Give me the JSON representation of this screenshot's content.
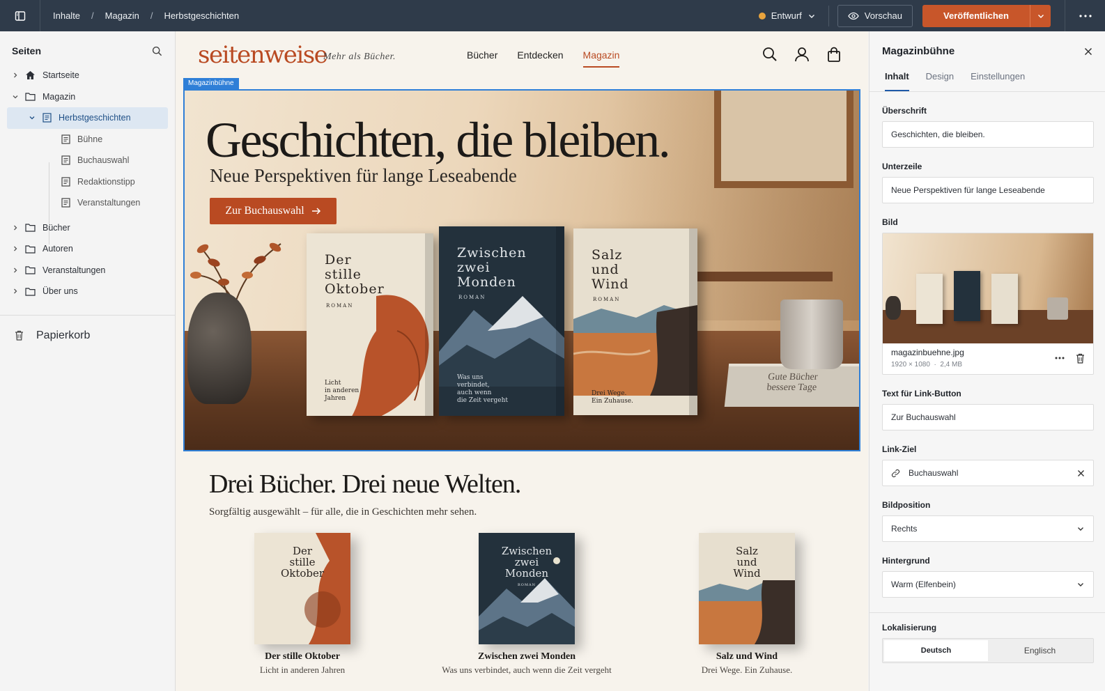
{
  "topbar": {
    "breadcrumbs": [
      "Inhalte",
      "Magazin",
      "Herbstgeschichten"
    ],
    "status": "Entwurf",
    "status_color": "#e8a33d",
    "preview_label": "Vorschau",
    "publish_label": "Veröffentlichen",
    "accent": "#c8562a"
  },
  "sidebar": {
    "title": "Seiten",
    "items": [
      {
        "label": "Startseite",
        "icon": "home-icon"
      },
      {
        "label": "Magazin",
        "icon": "folder-icon"
      },
      {
        "label": "Herbstgeschichten",
        "icon": "page-icon"
      },
      {
        "label": "Bühne",
        "icon": "page-icon"
      },
      {
        "label": "Buchauswahl",
        "icon": "page-icon"
      },
      {
        "label": "Redaktionstipp",
        "icon": "page-icon"
      },
      {
        "label": "Veranstaltungen",
        "icon": "page-icon"
      },
      {
        "label": "Bücher",
        "icon": "folder-icon"
      },
      {
        "label": "Autoren",
        "icon": "folder-icon"
      },
      {
        "label": "Veranstaltungen",
        "icon": "folder-icon"
      },
      {
        "label": "Über uns",
        "icon": "folder-icon"
      }
    ],
    "trash_label": "Papierkorb"
  },
  "site": {
    "logo": "seitenweise",
    "tagline": "Mehr als Bücher.",
    "menu": [
      "Bücher",
      "Entdecken",
      "Magazin"
    ],
    "stage_tag": "Magazinbühne",
    "hero": {
      "title": "Geschichten, die bleiben.",
      "subtitle": "Neue Perspektiven für lange Leseabende",
      "button": "Zur Buchauswahl"
    },
    "hero_books": [
      {
        "title": [
          "Der",
          "stille",
          "Oktober"
        ],
        "label": "ROMAN",
        "tagline": [
          "Licht",
          "in anderen",
          "Jahren"
        ]
      },
      {
        "title": [
          "Zwischen",
          "zwei",
          "Monden"
        ],
        "label": "ROMAN",
        "tagline": [
          "Was uns",
          "verbindet,",
          "auch wenn",
          "die Zeit vergeht"
        ]
      },
      {
        "title": [
          "Salz",
          "und",
          "Wind"
        ],
        "label": "ROMAN",
        "tagline": [
          "Drei Wege.",
          "Ein Zuhause."
        ]
      }
    ],
    "stack_books": [
      "Gute Bücher",
      "bessere Tage"
    ],
    "section": {
      "title": "Drei Bücher. Drei neue Welten.",
      "subtitle": "Sorgfältig ausgewählt – für alle, die in Geschichten mehr sehen."
    },
    "cards": [
      {
        "cover": [
          "Der",
          "stille",
          "Oktober"
        ],
        "name": "Der stille Oktober",
        "desc": "Licht in anderen Jahren"
      },
      {
        "cover": [
          "Zwischen",
          "zwei",
          "Monden"
        ],
        "cover_label": "ROMAN",
        "name": "Zwischen zwei Monden",
        "desc": "Was uns verbindet, auch wenn die Zeit vergeht"
      },
      {
        "cover": [
          "Salz",
          "und",
          "Wind"
        ],
        "name": "Salz und Wind",
        "desc": "Drei Wege. Ein Zuhause."
      }
    ]
  },
  "panel": {
    "title": "Magazinbühne",
    "tabs": [
      "Inhalt",
      "Design",
      "Einstellungen"
    ],
    "fields": {
      "headline_label": "Überschrift",
      "headline_value": "Geschichten, die bleiben.",
      "subline_label": "Unterzeile",
      "subline_value": "Neue Perspektiven für lange Leseabende",
      "image_label": "Bild",
      "image_name": "magazinbuehne.jpg",
      "image_dims": "1920 × 1080",
      "image_size": "2,4 MB",
      "button_text_label": "Text für Link-Button",
      "button_text_value": "Zur Buchauswahl",
      "link_label": "Link-Ziel",
      "link_value": "Buchauswahl",
      "position_label": "Bildposition",
      "position_value": "Rechts",
      "background_label": "Hintergrund",
      "background_value": "Warm (Elfenbein)",
      "locale_label": "Lokalisierung",
      "locale_options": [
        "Deutsch",
        "Englisch"
      ],
      "locale_selected": "Deutsch"
    }
  }
}
